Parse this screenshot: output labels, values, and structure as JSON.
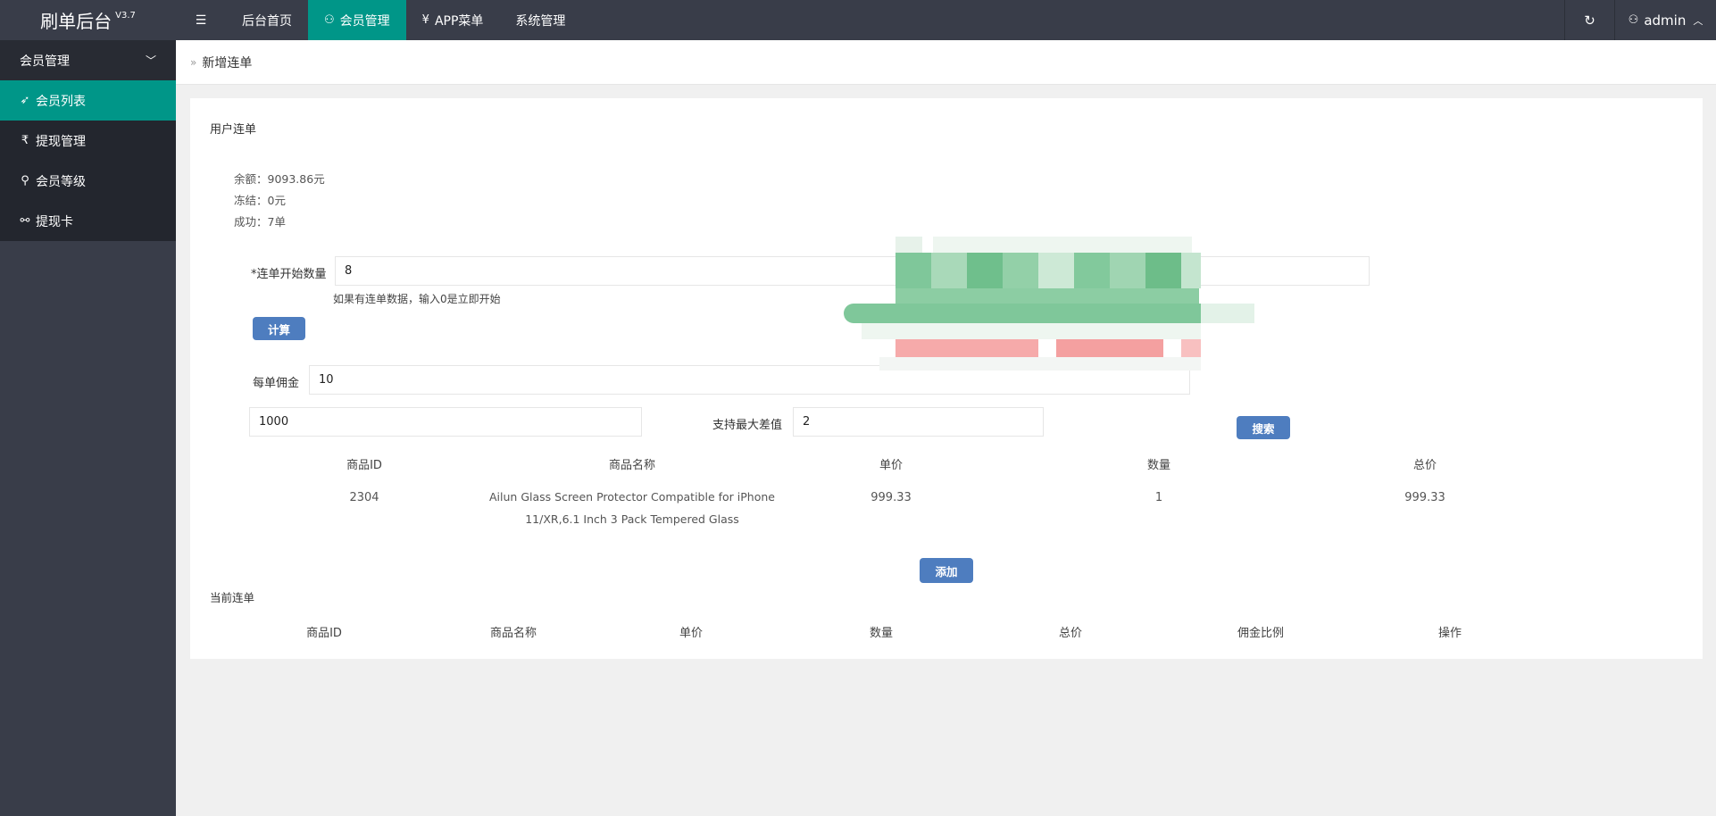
{
  "header": {
    "brand": "刷单后台",
    "version": "V3.7",
    "nav": [
      {
        "label": "后台首页",
        "active": false
      },
      {
        "label": "会员管理",
        "active": true
      },
      {
        "label": "APP菜单",
        "active": false
      },
      {
        "label": "系统管理",
        "active": false
      }
    ],
    "user": "admin"
  },
  "sidebar": {
    "group": "会员管理",
    "items": [
      {
        "label": "会员列表",
        "active": true
      },
      {
        "label": "提现管理",
        "active": false
      },
      {
        "label": "会员等级",
        "active": false
      },
      {
        "label": "提现卡",
        "active": false
      }
    ]
  },
  "breadcrumb": "新增连单",
  "form": {
    "section_title": "用户连单",
    "balance": "余额：9093.86元",
    "frozen": "冻结：0元",
    "success": "成功：7单",
    "start_qty_label": "*连单开始数量",
    "start_qty_value": "8",
    "start_qty_hint": "如果有连单数据，输入0是立即开始",
    "calc_button": "计算",
    "commission_label": "每单佣金",
    "commission_value": "10",
    "amount_value": "1000",
    "max_diff_label": "支持最大差值",
    "max_diff_value": "2",
    "search_button": "搜索",
    "add_button": "添加"
  },
  "result_table": {
    "headers": [
      "商品ID",
      "商品名称",
      "单价",
      "数量",
      "总价"
    ],
    "rows": [
      {
        "id": "2304",
        "name": "Ailun Glass Screen Protector Compatible for iPhone 11/XR,6.1 Inch 3 Pack Tempered Glass",
        "price": "999.33",
        "qty": "1",
        "total": "999.33"
      }
    ]
  },
  "current": {
    "title": "当前连单",
    "headers": [
      "商品ID",
      "商品名称",
      "单价",
      "数量",
      "总价",
      "佣金比例",
      "操作"
    ]
  },
  "colors": {
    "header_bg": "#393d49",
    "accent": "#009688",
    "button": "#4e7dbf"
  }
}
